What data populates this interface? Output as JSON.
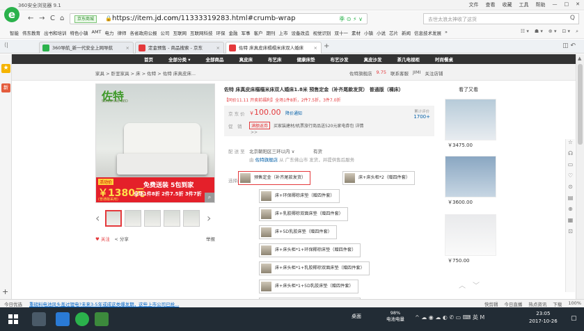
{
  "window": {
    "title": "360安全浏览器 9.1",
    "menu": [
      "文件",
      "查看",
      "收藏",
      "工具",
      "帮助"
    ],
    "controls": [
      "—",
      "□",
      "✕"
    ]
  },
  "nav": {
    "back": "←",
    "forward": "→",
    "refresh": "C",
    "home": "⌂"
  },
  "address": {
    "chip": "京东商城",
    "protocol": "https://",
    "url_prefix": "item.",
    "domain": "jd.com",
    "url_suffix": "/11333319283.html#crumb-wrap",
    "tools": "季 ⊙ ⚡ ∨"
  },
  "search": {
    "placeholder": "去世太浪太神收了这货",
    "icon": "Q"
  },
  "bookmarks": {
    "items": [
      "智能",
      "伟东教育",
      "出书和培训",
      "特色小镇",
      "AMT",
      "电力",
      "律师",
      "各省政府公报",
      "公司",
      "互联网",
      "互联网科技",
      "环保",
      "金融",
      "军事",
      "客户",
      "期刊",
      "上市",
      "设备改造",
      "视觉识别",
      "双十一",
      "素材",
      "小镇",
      "小说",
      "芯片",
      "新闻",
      "信息技术发展",
      "»"
    ],
    "right": [
      "☷ ▾",
      "☗ ▾",
      "⊕ ▾",
      "⊡ ▾",
      "⌕"
    ]
  },
  "tabs": [
    {
      "title": "360导航_新一代安全上网导航",
      "color": "#2bb24c"
    },
    {
      "title": "定金预售 - 商品搜索 - 京东",
      "color": "#e4393c"
    },
    {
      "title": "佐特 床真皮床榻榻米床双人婚床",
      "color": "#e4393c"
    }
  ],
  "tabs_right": "◫ ↶",
  "sidebar": {
    "star": "★",
    "new": "新",
    "plus": "+"
  },
  "jd_nav": [
    "首页",
    "全部分类 ▾",
    "全部商品",
    "真皮床",
    "布艺床",
    "健康床垫",
    "布艺沙发",
    "真皮沙发",
    "茶几电视柜",
    "时尚餐桌"
  ],
  "crumb": {
    "path": "家具 > 卧室家具 > 床 > 佐特 > 佐特 床真皮床...",
    "shop": "佐特旗舰店",
    "score": "9.75",
    "service": "联系客服",
    "chat": "JIMI",
    "follow": "关注店铺"
  },
  "product": {
    "brand": "佐特",
    "slogan": "SUNSHINE BED",
    "title": "佐特 床真皮床榻榻米床双人婚床1.8米 预售定金（补齐尾款发货） 普通版（裸床）",
    "promo": "【同价11.11 开卖前福利】全场1件8折，2件7.5折，3件7.0折",
    "price_label": "京 东 价",
    "price_currency": "￥",
    "price": "100.00",
    "notify": "降价通知",
    "reviews_label": "累计评价",
    "reviews": "1700+",
    "cx_label": "促　销",
    "full_tag": "满额返券",
    "cx_desc": "买家装建材/机票旅行商品送520元家电券包 详情",
    "cx_more": ">>",
    "ship_label": "配 送 至",
    "ship_addr": "北京朝阳区三环以内 ∨",
    "stock": "有货",
    "ship_sub_prefix": "由",
    "ship_sub_shop": "佐特旗舰店",
    "ship_sub_rest": "从 广东佛山市 发货，并提供售后服务",
    "opts_label": "选择颜色",
    "options": [
      "预售定金（补齐尾款发货）",
      "床+床头柜*2（赠四件套）",
      "床+环保椰棕床垫（赠四件套）",
      "床+乳胶椰棕双面床垫（赠四件套）",
      "床+5D乳胶床垫（赠四件套）",
      "床+床头柜*1+环保椰棕床垫（赠四件套）",
      "床+床头柜*1+乳胶椰棕双面床垫（赠四件套）",
      "床+床头柜*1+5D乳胶床垫（赠四件套）",
      "床+床头柜*2+环保椰棕床垫（赠四件套）"
    ],
    "image_promo": {
      "tag": "活动价",
      "price": "￥1380元",
      "note": "(普通版采用)",
      "headline": "免费送装 5包到家",
      "sub": "全场1件8折 2件7.5折 3件7折"
    },
    "follow": "♥ 关注",
    "share": "< 分享",
    "report": "举报"
  },
  "recommend": {
    "title": "看了又看",
    "items": [
      {
        "price": "￥3475.00"
      },
      {
        "price": "￥3600.00"
      },
      {
        "price": "￥750.00"
      }
    ],
    "arrows": "︿　﹀"
  },
  "rightbar": [
    "☆",
    "☊",
    "▭",
    "♡",
    "⊙",
    "▤",
    "⊕",
    "▦",
    "⊡"
  ],
  "statusbar": {
    "today": "今日优选",
    "news": "重磅料电池风头盖过锂电?未来3-5年或成这类爆发期，这些上市公司已抢...",
    "right": [
      "快剪辑",
      "今日直播",
      "热点资讯",
      "下载",
      "100%"
    ]
  },
  "taskbar": {
    "tray_text": "桌面",
    "battery": "98%",
    "battery_label": "电池电量",
    "ime": "英",
    "time": "23:05",
    "date": "2017-10-26",
    "notif": "▢"
  }
}
